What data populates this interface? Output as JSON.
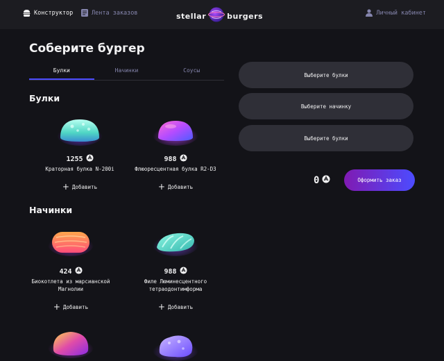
{
  "header": {
    "constructor_label": "Конструктор",
    "feed_label": "Лента заказов",
    "logo_left": "stellar",
    "logo_right": "burgers",
    "account_label": "Личный кабинет"
  },
  "main": {
    "title": "Соберите бургер",
    "tabs": [
      {
        "label": "Булки",
        "active": true
      },
      {
        "label": "Начинки",
        "active": false
      },
      {
        "label": "Соусы",
        "active": false
      }
    ],
    "sections": [
      {
        "title": "Булки",
        "items": [
          {
            "price": "1255",
            "name": "Краторная булка N-200i",
            "add_label": "Добавить",
            "image": "bun-teal"
          },
          {
            "price": "988",
            "name": "Флюоресцентная булка R2-D3",
            "add_label": "Добавить",
            "image": "bun-purple"
          }
        ]
      },
      {
        "title": "Начинки",
        "items": [
          {
            "price": "424",
            "name": "Биокотлета из марсианской Магнолии",
            "add_label": "Добавить",
            "image": "patty-orange"
          },
          {
            "price": "988",
            "name": "Филе Люминесцентного тетраодонтимформа",
            "add_label": "Добавить",
            "image": "fish-fillet"
          },
          {
            "image": "sauce-gold"
          },
          {
            "image": "cheese-violet"
          }
        ]
      }
    ]
  },
  "order": {
    "slots": [
      "Выберите булки",
      "Выберите начинку",
      "Выберите булки"
    ],
    "total": "0",
    "button_label": "Оформить заказ"
  },
  "icons": {
    "currency": "currency-icon",
    "burger": "burger-icon",
    "list": "list-icon",
    "profile": "profile-icon",
    "plus": "plus-icon"
  },
  "colors": {
    "background": "#131318",
    "header": "#1c1c21",
    "slot": "#2f2f37",
    "accent": "#4c4cff",
    "gradient_start": "#801ab2",
    "muted_text": "#8585ad"
  }
}
